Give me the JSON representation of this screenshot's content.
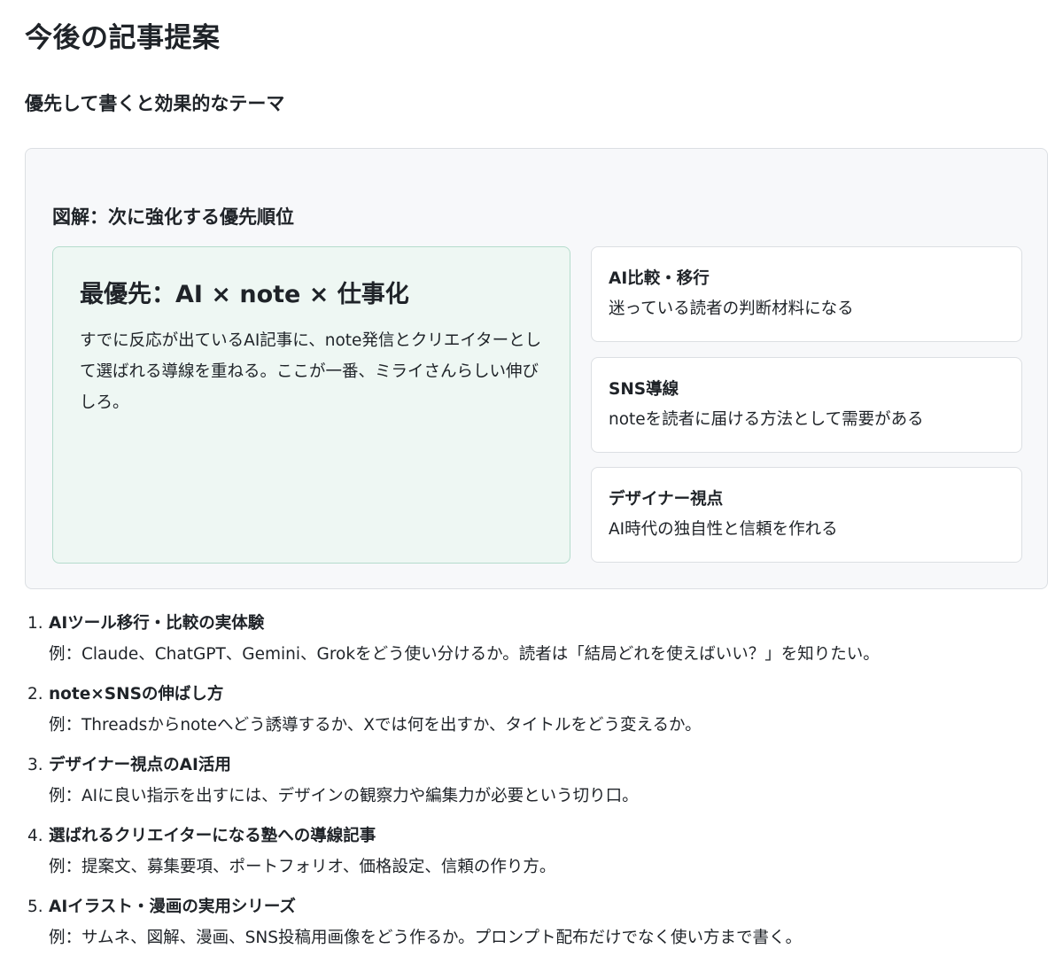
{
  "page": {
    "title": "今後の記事提案",
    "subtitle": "優先して書くと効果的なテーマ"
  },
  "diagram": {
    "heading": "図解：次に強化する優先順位",
    "priority": {
      "title": "最優先：AI × note × 仕事化",
      "body": "すでに反応が出ているAI記事に、note発信とクリエイターとして選ばれる導線を重ねる。ここが一番、ミライさんらしい伸びしろ。"
    },
    "cards": [
      {
        "title": "AI比較・移行",
        "desc": "迷っている読者の判断材料になる"
      },
      {
        "title": "SNS導線",
        "desc": "noteを読者に届ける方法として需要がある"
      },
      {
        "title": "デザイナー視点",
        "desc": "AI時代の独自性と信頼を作れる"
      }
    ]
  },
  "ideas": [
    {
      "num": "1.",
      "title": "AIツール移行・比較の実体験",
      "example": "例：Claude、ChatGPT、Gemini、Grokをどう使い分けるか。読者は「結局どれを使えばいい？」を知りたい。"
    },
    {
      "num": "2.",
      "title": "note×SNSの伸ばし方",
      "example": "例：Threadsからnoteへどう誘導するか、Xでは何を出すか、タイトルをどう変えるか。"
    },
    {
      "num": "3.",
      "title": "デザイナー視点のAI活用",
      "example": "例：AIに良い指示を出すには、デザインの観察力や編集力が必要という切り口。"
    },
    {
      "num": "4.",
      "title": "選ばれるクリエイターになる塾への導線記事",
      "example": "例：提案文、募集要項、ポートフォリオ、価格設定、信頼の作り方。"
    },
    {
      "num": "5.",
      "title": "AIイラスト・漫画の実用シリーズ",
      "example": "例：サムネ、図解、漫画、SNS投稿用画像をどう作るか。プロンプト配布だけでなく使い方まで書く。"
    }
  ]
}
